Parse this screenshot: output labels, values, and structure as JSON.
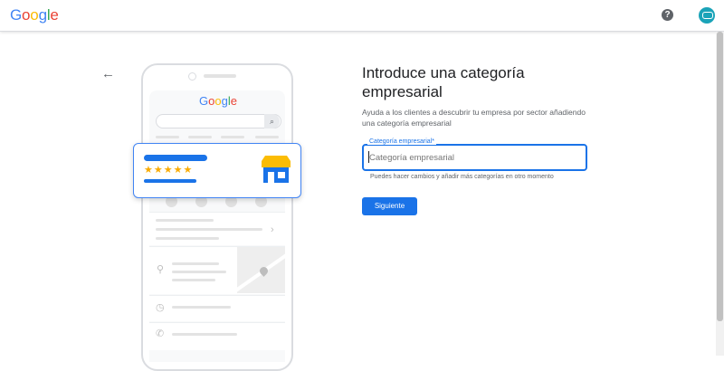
{
  "header": {
    "logo_letters": [
      {
        "ch": "G",
        "color": "#4285F4"
      },
      {
        "ch": "o",
        "color": "#EA4335"
      },
      {
        "ch": "o",
        "color": "#FBBC05"
      },
      {
        "ch": "g",
        "color": "#4285F4"
      },
      {
        "ch": "l",
        "color": "#34A853"
      },
      {
        "ch": "e",
        "color": "#EA4335"
      }
    ],
    "help_icon": "?",
    "avatar_icon": "account-avatar"
  },
  "illustration": {
    "mini_logo": "Google",
    "stars": "★★★★★"
  },
  "form": {
    "back_icon": "←",
    "title": "Introduce una categoría empresarial",
    "description": "Ayuda a los clientes a descubrir tu empresa por sector añadiendo una categoría empresarial",
    "field_label": "Categoría empresarial*",
    "field_placeholder": "Categoría empresarial",
    "field_value": "",
    "hint": "Puedes hacer cambios y añadir más categorías en otro momento",
    "submit_label": "Siguiente"
  },
  "colors": {
    "accent": "#1a73e8",
    "star": "#f9ab00"
  }
}
